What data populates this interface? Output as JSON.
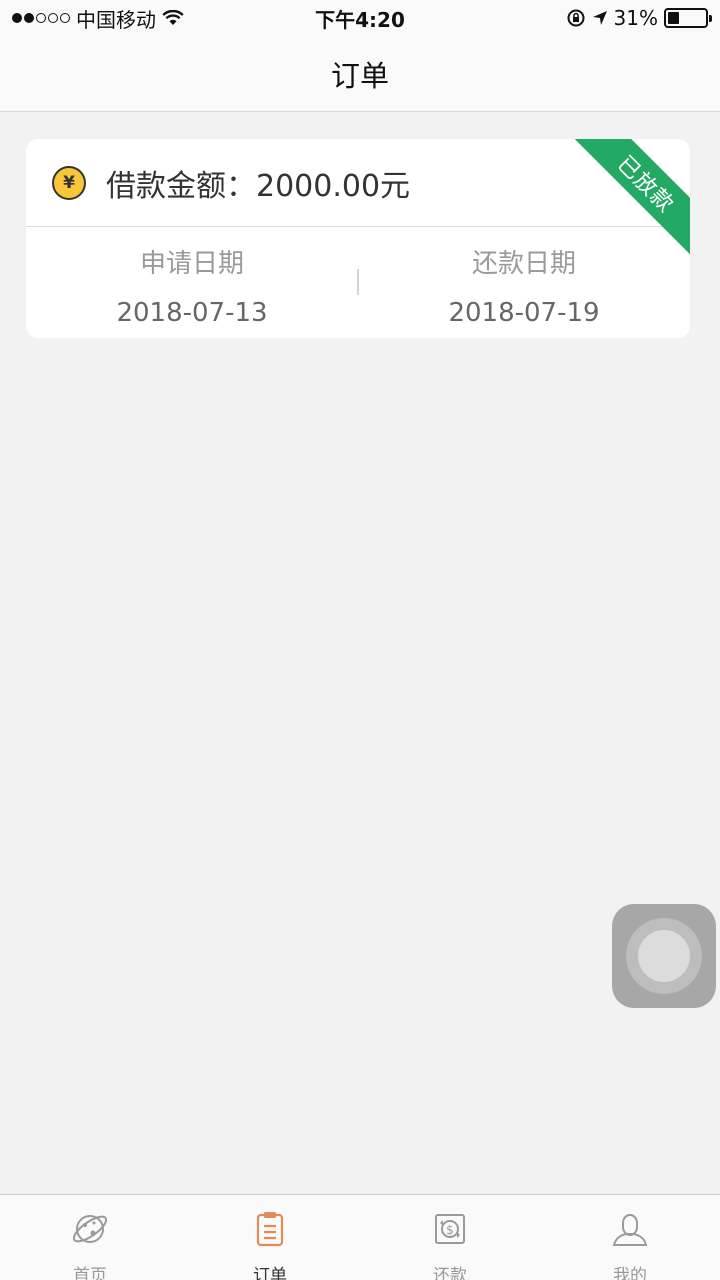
{
  "status_bar": {
    "carrier": "中国移动",
    "time": "下午4:20",
    "battery": "31%",
    "battery_level": 0.31
  },
  "nav": {
    "title": "订单"
  },
  "order": {
    "amount_label": "借款金额：",
    "amount_value": "2000.00元",
    "status": "已放款",
    "apply_label": "申请日期",
    "apply_date": "2018-07-13",
    "repay_label": "还款日期",
    "repay_date": "2018-07-19"
  },
  "tabs": [
    {
      "label": "首页",
      "icon": "planet-icon"
    },
    {
      "label": "订单",
      "icon": "clipboard-icon",
      "active": true
    },
    {
      "label": "还款",
      "icon": "dollar-cycle-icon"
    },
    {
      "label": "我的",
      "icon": "user-icon"
    }
  ],
  "colors": {
    "accent": "#e58a52",
    "status_green": "#24a964",
    "yen": "#f8c63a"
  }
}
